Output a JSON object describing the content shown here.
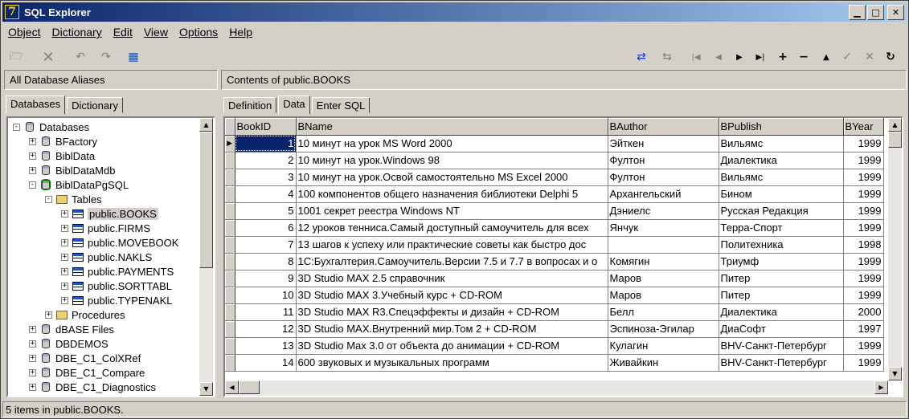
{
  "window": {
    "title": "SQL Explorer",
    "controls": [
      "_",
      "□",
      "×"
    ]
  },
  "menu": [
    {
      "label": "Object",
      "accel": "O"
    },
    {
      "label": "Dictionary",
      "accel": "D"
    },
    {
      "label": "Edit",
      "accel": "E"
    },
    {
      "label": "View",
      "accel": "V"
    },
    {
      "label": "Options",
      "accel": "O"
    },
    {
      "label": "Help",
      "accel": "H"
    }
  ],
  "left_panel": {
    "header": "All Database Aliases",
    "tabs": [
      "Databases",
      "Dictionary"
    ],
    "active_tab": "Databases",
    "tree": [
      {
        "label": "Databases",
        "level": 0,
        "expander": "-",
        "icon": "databases-icon"
      },
      {
        "label": "BFactory",
        "level": 1,
        "expander": "+",
        "icon": "database-icon"
      },
      {
        "label": "BiblData",
        "level": 1,
        "expander": "+",
        "icon": "database-icon"
      },
      {
        "label": "BiblDataMdb",
        "level": 1,
        "expander": "+",
        "icon": "database-icon"
      },
      {
        "label": "BiblDataPgSQL",
        "level": 1,
        "expander": "-",
        "icon": "database-connected-icon"
      },
      {
        "label": "Tables",
        "level": 2,
        "expander": "-",
        "icon": "folder-icon"
      },
      {
        "label": "public.BOOKS",
        "level": 3,
        "expander": "+",
        "icon": "table-icon",
        "selected": true
      },
      {
        "label": "public.FIRMS",
        "level": 3,
        "expander": "+",
        "icon": "table-icon"
      },
      {
        "label": "public.MOVEBOOK",
        "level": 3,
        "expander": "+",
        "icon": "table-icon"
      },
      {
        "label": "public.NAKLS",
        "level": 3,
        "expander": "+",
        "icon": "table-icon"
      },
      {
        "label": "public.PAYMENTS",
        "level": 3,
        "expander": "+",
        "icon": "table-icon"
      },
      {
        "label": "public.SORTTABL",
        "level": 3,
        "expander": "+",
        "icon": "table-icon"
      },
      {
        "label": "public.TYPENAKL",
        "level": 3,
        "expander": "+",
        "icon": "table-icon"
      },
      {
        "label": "Procedures",
        "level": 2,
        "expander": "+",
        "icon": "folder-icon"
      },
      {
        "label": "dBASE Files",
        "level": 1,
        "expander": "+",
        "icon": "database-icon"
      },
      {
        "label": "DBDEMOS",
        "level": 1,
        "expander": "+",
        "icon": "database-icon"
      },
      {
        "label": "DBE_C1_ColXRef",
        "level": 1,
        "expander": "+",
        "icon": "database-icon"
      },
      {
        "label": "DBE_C1_Compare",
        "level": 1,
        "expander": "+",
        "icon": "database-icon"
      },
      {
        "label": "DBE_C1_Diagnostics",
        "level": 1,
        "expander": "+",
        "icon": "database-icon"
      }
    ]
  },
  "right_panel": {
    "header": "Contents of public.BOOKS",
    "tabs": [
      "Definition",
      "Data",
      "Enter SQL"
    ],
    "active_tab": "Data",
    "grid": {
      "columns": [
        "BookID",
        "BName",
        "BAuthor",
        "BPublish",
        "BYear"
      ],
      "rows": [
        [
          "1",
          "10 минут на урок MS Word 2000",
          "Эйткен",
          "Вильямс",
          "1999"
        ],
        [
          "2",
          "10 минут на урок.Windows 98",
          "Фултон",
          "Диалектика",
          "1999"
        ],
        [
          "3",
          "10 минут на урок.Освой самостоятельно MS Excel 2000",
          "Фултон",
          "Вильямс",
          "1999"
        ],
        [
          "4",
          "100 компонентов общего назначения библиотеки Delphi 5",
          "Архангельский",
          "Бином",
          "1999"
        ],
        [
          "5",
          "1001 секрет реестра Windows NT",
          "Дэниелс",
          "Русская Редакция",
          "1999"
        ],
        [
          "6",
          "12 уроков тенниса.Самый доступный самоучитель для всех",
          "Янчук",
          "Терра-Спорт",
          "1999"
        ],
        [
          "7",
          "13 шагов к успеху или практические советы как быстро дос",
          "",
          "Политехника",
          "1998"
        ],
        [
          "8",
          "1С:Бухгалтерия.Самоучитель.Версии 7.5 и 7.7 в вопросах и о",
          "Комягин",
          "Триумф",
          "1999"
        ],
        [
          "9",
          "3D Studio MAX 2.5 справочник",
          "Маров",
          "Питер",
          "1999"
        ],
        [
          "10",
          "3D Studio MAX 3.Учебный курс + CD-ROM",
          "Маров",
          "Питер",
          "1999"
        ],
        [
          "11",
          "3D Studio MAX R3.Спецэффекты и дизайн + CD-ROM",
          "Белл",
          "Диалектика",
          "2000"
        ],
        [
          "12",
          "3D Studio MAX.Внутренний мир.Том 2 + CD-ROM",
          "Эспиноза-Эгилар",
          "ДиаСофт",
          "1997"
        ],
        [
          "13",
          "3D Studio Max 3.0 от объекта до анимации + CD-ROM",
          "Кулагин",
          "BHV-Санкт-Петербург",
          "1999"
        ],
        [
          "14",
          "600 звуковых и музыкальных программ",
          "Живайкин",
          "BHV-Санкт-Петербург",
          "1999"
        ]
      ]
    }
  },
  "status": "5 items in public.BOOKS."
}
